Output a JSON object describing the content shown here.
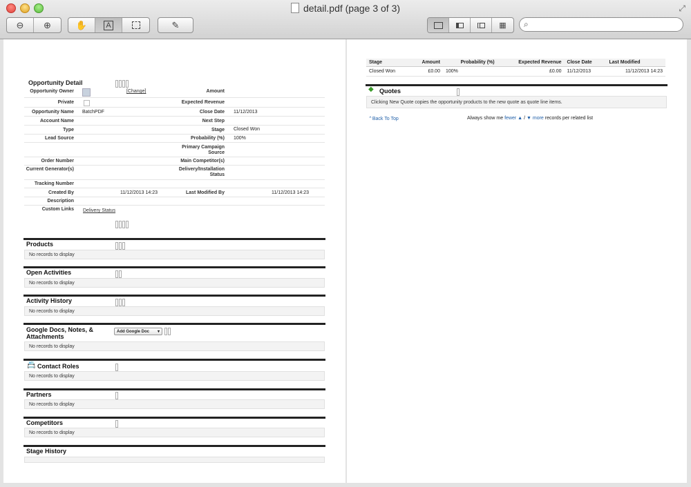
{
  "window": {
    "title": "detail.pdf (page 3 of 3)"
  },
  "toolbar": {
    "zoom_out_icon": "minus-magnifier",
    "zoom_in_icon": "plus-magnifier",
    "hand_icon": "hand",
    "text_icon": "A",
    "select_icon": "dashed-rect",
    "annotate_icon": "pencil",
    "search_placeholder": ""
  },
  "page1": {
    "section_title": "Opportunity Detail",
    "fields_left": [
      {
        "label": "Opportunity Owner",
        "value": "[Change]"
      },
      {
        "label": "Private",
        "value": ""
      },
      {
        "label": "Opportunity Name",
        "value": "BatchPDF"
      },
      {
        "label": "Account Name",
        "value": ""
      },
      {
        "label": "Type",
        "value": ""
      },
      {
        "label": "Lead Source",
        "value": ""
      },
      {
        "label": "Order Number",
        "value": ""
      },
      {
        "label": "Current Generator(s)",
        "value": ""
      },
      {
        "label": "Tracking Number",
        "value": ""
      },
      {
        "label": "Created By",
        "value": "11/12/2013 14:23"
      },
      {
        "label": "Description",
        "value": ""
      },
      {
        "label": "Custom Links",
        "value": "Delivery Status"
      }
    ],
    "fields_right": [
      {
        "label": "Amount",
        "value": ""
      },
      {
        "label": "Expected Revenue",
        "value": ""
      },
      {
        "label": "Close Date",
        "value": "11/12/2013"
      },
      {
        "label": "Next Step",
        "value": ""
      },
      {
        "label": "Stage",
        "value": "Closed Won"
      },
      {
        "label": "Probability (%)",
        "value": "100%"
      },
      {
        "label": "Primary Campaign",
        "value": ""
      },
      {
        "label": "Source",
        "value": ""
      },
      {
        "label": "Main Competitor(s)",
        "value": ""
      },
      {
        "label": "Delivery/Installation",
        "value": ""
      },
      {
        "label": "Status",
        "value": ""
      },
      {
        "label": "Last Modified By",
        "value": "11/12/2013 14:23"
      }
    ],
    "sections": [
      {
        "title": "Products",
        "message": "No records to display"
      },
      {
        "title": "Open Activities",
        "message": "No records to display"
      },
      {
        "title": "Activity History",
        "message": "No records to display"
      },
      {
        "title": "Google Docs, Notes, &",
        "title2": "Attachments",
        "message": "No records to display",
        "button": "Add Google Doc"
      },
      {
        "title": "Contact Roles",
        "message": "No records to display"
      },
      {
        "title": "Partners",
        "message": "No records to display"
      },
      {
        "title": "Competitors",
        "message": "No records to display"
      },
      {
        "title": "Stage History",
        "message": ""
      }
    ]
  },
  "page2": {
    "stage_table": {
      "headers": [
        "Stage",
        "Amount",
        "Probability (%)",
        "Expected Revenue",
        "Close Date",
        "Last Modified"
      ],
      "row": [
        "Closed Won",
        "£0.00",
        "100%",
        "£0.00",
        "11/12/2013",
        "11/12/2013 14:23"
      ]
    },
    "quotes": {
      "title": "Quotes",
      "message": "Clicking New Quote copies the opportunity products to the new quote as quote line items."
    },
    "back_to_top": "Back To Top",
    "always_show": "Always show me",
    "fewer": "fewer",
    "slash": "/",
    "more": "more",
    "records_text": "records per related list"
  }
}
